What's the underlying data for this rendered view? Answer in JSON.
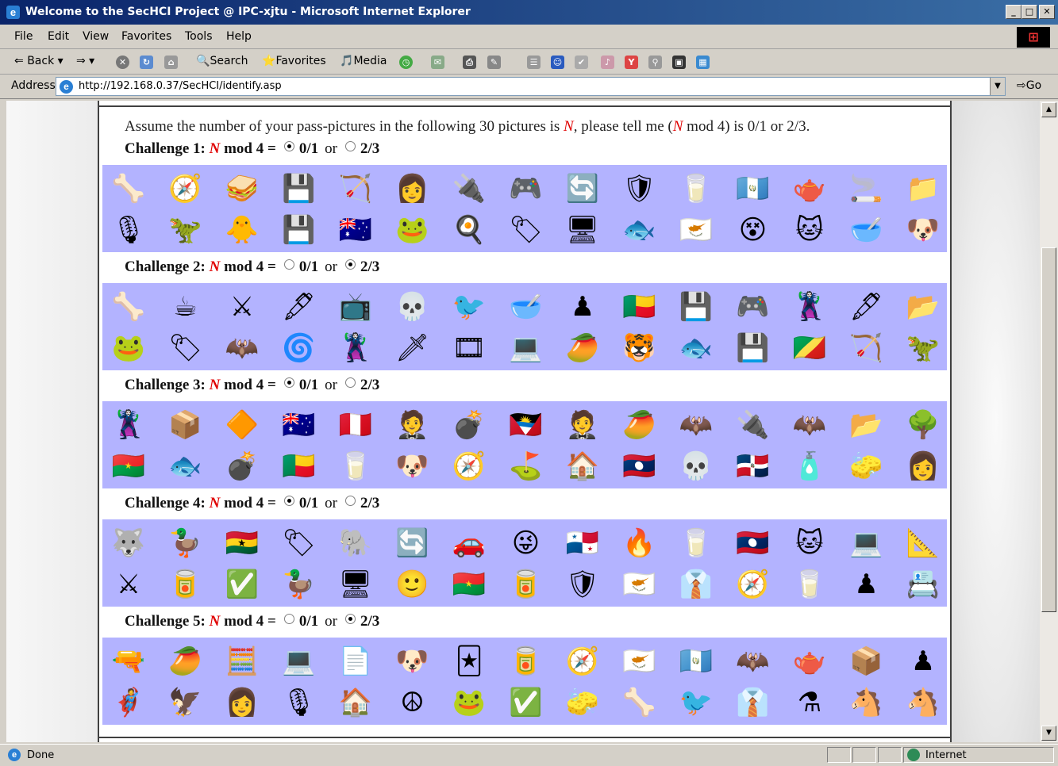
{
  "window": {
    "title": "Welcome to the SecHCI Project @ IPC-xjtu - Microsoft Internet Explorer",
    "buttons": {
      "minimize": "_",
      "maximize": "□",
      "close": "✕"
    }
  },
  "menu": [
    "File",
    "Edit",
    "View",
    "Favorites",
    "Tools",
    "Help"
  ],
  "toolbar": {
    "back": "Back",
    "search": "Search",
    "favorites": "Favorites",
    "media": "Media"
  },
  "address": {
    "label": "Address",
    "url": "http://192.168.0.37/SecHCI/identify.asp",
    "go": "Go"
  },
  "page": {
    "instruction": {
      "pre": "Assume the number of your pass-pictures in the following 30 pictures is ",
      "var1": "N",
      "mid": ", please tell me (",
      "var2": "N",
      "post": " mod 4) is 0/1 or 2/3."
    },
    "challenges": [
      {
        "label": "Challenge 1:",
        "var": "N",
        "expr": "mod 4 =",
        "opt1": "0/1",
        "or": "or",
        "opt2": "2/3",
        "selected": "0/1",
        "rows": [
          [
            "🦴",
            "🧭",
            "🥪",
            "💾",
            "🏹",
            "👩",
            "🔌",
            "🎮",
            "🔄",
            "🛡",
            "🥛",
            "🇬🇹",
            "🫖",
            "🚬",
            "📁"
          ],
          [
            "🎙",
            "🦖",
            "🐥",
            "💾",
            "🇦🇺",
            "🐸",
            "🍳",
            "🏷",
            "🖥",
            "🐟",
            "🇨🇾",
            "😵",
            "🐱",
            "🥣",
            "🐶"
          ]
        ]
      },
      {
        "label": "Challenge 2:",
        "var": "N",
        "expr": "mod 4 =",
        "opt1": "0/1",
        "or": "or",
        "opt2": "2/3",
        "selected": "2/3",
        "rows": [
          [
            "🦴",
            "☕",
            "⚔",
            "🖋",
            "📺",
            "💀",
            "🐦",
            "🥣",
            "♟",
            "🇧🇯",
            "💾",
            "🎮",
            "🦹",
            "🖋",
            "📂"
          ],
          [
            "🐸",
            "🏷",
            "🦇",
            "🌀",
            "🦹",
            "🗡",
            "🎞",
            "💻",
            "🥭",
            "🐯",
            "🐟",
            "💾",
            "🇨🇬",
            "🏹",
            "🦖"
          ]
        ]
      },
      {
        "label": "Challenge 3:",
        "var": "N",
        "expr": "mod 4 =",
        "opt1": "0/1",
        "or": "or",
        "opt2": "2/3",
        "selected": "0/1",
        "rows": [
          [
            "🦹",
            "📦",
            "🔶",
            "🇦🇺",
            "🇵🇪",
            "🤵",
            "💣",
            "🇦🇬",
            "🤵",
            "🥭",
            "🦇",
            "🔌",
            "🦇",
            "📂",
            "🌳"
          ],
          [
            "🇧🇫",
            "🐟",
            "💣",
            "🇧🇯",
            "🥛",
            "🐶",
            "🧭",
            "⛳",
            "🏠",
            "🇱🇦",
            "💀",
            "🇩🇴",
            "🧴",
            "🧽",
            "👩"
          ]
        ]
      },
      {
        "label": "Challenge 4:",
        "var": "N",
        "expr": "mod 4 =",
        "opt1": "0/1",
        "or": "or",
        "opt2": "2/3",
        "selected": "0/1",
        "rows": [
          [
            "🐺",
            "🦆",
            "🇬🇭",
            "🏷",
            "🐘",
            "🔄",
            "🚗",
            "😜",
            "🇵🇦",
            "🔥",
            "🥛",
            "🇱🇦",
            "🐱",
            "💻",
            "📐"
          ],
          [
            "⚔",
            "🥫",
            "✅",
            "🦆",
            "🖥",
            "🙂",
            "🇧🇫",
            "🥫",
            "🛡",
            "🇨🇾",
            "👔",
            "🧭",
            "🥛",
            "♟",
            "📇"
          ]
        ]
      },
      {
        "label": "Challenge 5:",
        "var": "N",
        "expr": "mod 4 =",
        "opt1": "0/1",
        "or": "or",
        "opt2": "2/3",
        "selected": "2/3",
        "rows": [
          [
            "🔫",
            "🥭",
            "🧮",
            "💻",
            "📄",
            "🐶",
            "🃏",
            "🥫",
            "🧭",
            "🇨🇾",
            "🇬🇹",
            "🦇",
            "🫖",
            "📦",
            "♟"
          ],
          [
            "🦸",
            "🦅",
            "👩",
            "🎙",
            "🏠",
            "☮",
            "🐸",
            "✅",
            "🧽",
            "🦴",
            "🐦",
            "👔",
            "⚗",
            "🐴",
            "🐴"
          ]
        ]
      }
    ]
  },
  "status": {
    "text": "Done",
    "zone": "Internet"
  }
}
